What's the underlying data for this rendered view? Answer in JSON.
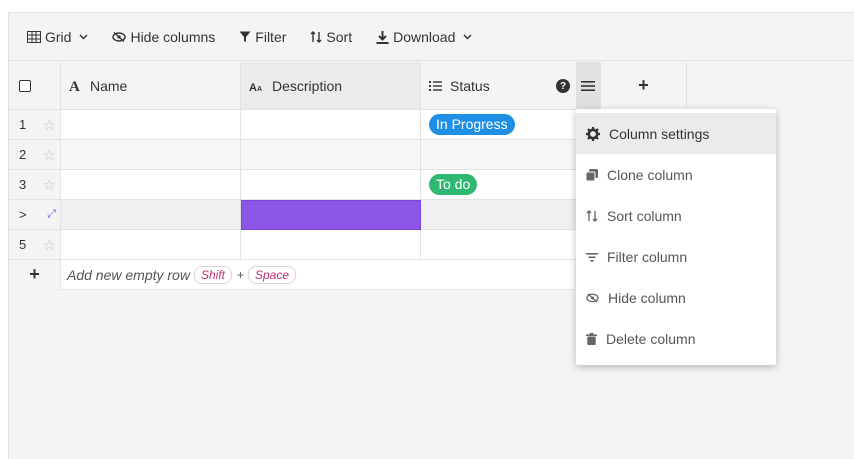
{
  "toolbar": {
    "grid_label": "Grid",
    "hide_columns_label": "Hide columns",
    "filter_label": "Filter",
    "sort_label": "Sort",
    "download_label": "Download"
  },
  "columns": [
    {
      "label": "Name",
      "icon": "text-type-icon"
    },
    {
      "label": "Description",
      "icon": "long-text-icon"
    },
    {
      "label": "Status",
      "icon": "list-icon"
    }
  ],
  "add_column_label": "+",
  "rows": [
    {
      "number": "1",
      "status": "In Progress",
      "status_color": "#1f8fe5"
    },
    {
      "number": "2",
      "status": ""
    },
    {
      "number": "3",
      "status": "To do",
      "status_color": "#2fb872"
    },
    {
      "number": ">",
      "status": ""
    },
    {
      "number": "5",
      "status": ""
    }
  ],
  "add_row": {
    "plus": "+",
    "text": "Add new empty row",
    "key1": "Shift",
    "key_plus": "+",
    "key2": "Space"
  },
  "context_menu": {
    "items": [
      {
        "label": "Column settings",
        "icon": "gear-icon"
      },
      {
        "label": "Clone column",
        "icon": "clone-icon"
      },
      {
        "label": "Sort column",
        "icon": "sort-icon"
      },
      {
        "label": "Filter column",
        "icon": "filter-icon"
      },
      {
        "label": "Hide column",
        "icon": "eye-slash-icon"
      },
      {
        "label": "Delete column",
        "icon": "trash-icon"
      }
    ]
  },
  "colors": {
    "accent": "#8b55e6",
    "in_progress": "#1f8fe5",
    "todo": "#2fb872",
    "shortcut_text": "#c4306d"
  }
}
